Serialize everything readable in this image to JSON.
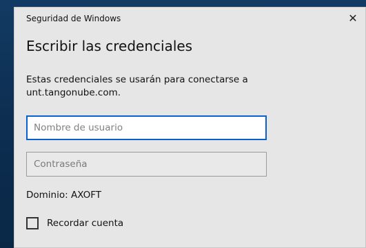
{
  "window": {
    "title": "Seguridad de Windows",
    "close_glyph": "✕"
  },
  "dialog": {
    "heading": "Escribir las credenciales",
    "description_line1": "Estas credenciales se usarán para conectarse a",
    "description_line2": "unt.tangonube.com.",
    "username": {
      "placeholder": "Nombre de usuario",
      "value": ""
    },
    "password": {
      "placeholder": "Contraseña",
      "value": ""
    },
    "domain_text": "Dominio: AXOFT",
    "remember": {
      "label": "Recordar cuenta",
      "checked": false
    }
  },
  "colors": {
    "dialog_bg": "#e6e6e6",
    "accent_focus": "#0a5fd0",
    "backdrop": "#0d2f52"
  },
  "icons": {
    "close": "close-icon"
  }
}
